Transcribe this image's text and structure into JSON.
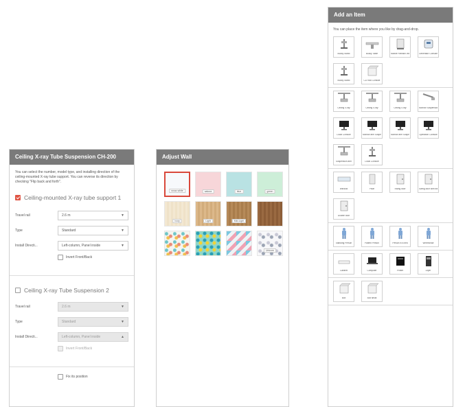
{
  "ceiling_panel": {
    "title": "Ceiling X-ray Tube Suspension CH-200",
    "description": "You can select the number, model type, and installing direction of the ceiling-mounted X-ray tube support. You can reverse its direction by checking \"Flip back and forth\".",
    "support1": {
      "label": "Ceiling-mounted X-ray tube support 1",
      "travel_rail_label": "Travel rail",
      "travel_rail_value": "2.6 m",
      "type_label": "Type",
      "type_value": "Standard",
      "install_label": "Install Directi...",
      "install_value": "Left-column, Panel inside",
      "invert_label": "Invert Front/Back"
    },
    "support2": {
      "label": "Ceiling X-ray Tube Suspension 2",
      "travel_rail_label": "Travel rail",
      "travel_rail_value": "2.6 m",
      "type_label": "Type",
      "type_value": "Standard",
      "install_label": "Install Directi...",
      "install_value": "Left-column, Panel inside",
      "invert_label": "Invert Front/Back"
    },
    "fix_label": "Fix its position"
  },
  "wall_panel": {
    "title": "Adjust Wall",
    "swatches": [
      {
        "label": "snow-white",
        "color": "#f7f9fc",
        "selected": true
      },
      {
        "label": "sakura",
        "color": "#f7d6d9"
      },
      {
        "label": "blue",
        "color": "#b9e2e3"
      },
      {
        "label": "green",
        "color": "#cdeed8"
      },
      {
        "label": "ivory",
        "cls": "wood1"
      },
      {
        "label": "Light",
        "cls": "wood2"
      },
      {
        "label": "Mid-Light",
        "cls": "wood3"
      },
      {
        "label": "",
        "cls": "wood4"
      },
      {
        "label": "",
        "cls": "pat1"
      },
      {
        "label": "",
        "cls": "pat2"
      },
      {
        "label": "",
        "cls": "pat3"
      },
      {
        "label": "Unicorn",
        "cls": "pat4"
      }
    ]
  },
  "add_panel": {
    "title": "Add an Item",
    "hint": "You can place the item where you like by drag-and-drop.",
    "groups": [
      [
        {
          "label": "Bucky Stand",
          "icon": "stand"
        },
        {
          "label": "Bucky Table",
          "icon": "table"
        },
        {
          "label": "Mobile Partition Wall",
          "icon": "partition"
        },
        {
          "label": "Generator Console",
          "icon": "console"
        },
        {
          "label": "Bucky Stand",
          "icon": "stand"
        },
        {
          "label": "CD Rad Console",
          "icon": "box"
        }
      ],
      [
        {
          "label": "Ceiling X-ray",
          "icon": "ceiling"
        },
        {
          "label": "Ceiling X-ray",
          "icon": "ceiling"
        },
        {
          "label": "Ceiling X-ray",
          "icon": "ceiling"
        },
        {
          "label": "Monitor Suspension",
          "icon": "arm"
        },
        {
          "label": "Local Console",
          "icon": "monitor"
        },
        {
          "label": "Monitor arm Suspension",
          "icon": "monitor"
        },
        {
          "label": "Monitor arm Suspension",
          "icon": "monitor"
        },
        {
          "label": "Operation Console",
          "icon": "monitor"
        },
        {
          "label": "Suspension arm",
          "icon": "ceiling"
        },
        {
          "label": "Local Console",
          "icon": "stand"
        }
      ],
      [
        {
          "label": "Window",
          "icon": "window"
        },
        {
          "label": "Pillar",
          "icon": "pillar"
        },
        {
          "label": "Swing door",
          "icon": "door"
        },
        {
          "label": "Swing door with window",
          "icon": "door"
        },
        {
          "label": "Double door",
          "icon": "door"
        }
      ],
      [
        {
          "label": "Standing Person",
          "icon": "person"
        },
        {
          "label": "Patient Person",
          "icon": "person"
        },
        {
          "label": "Person in a bed",
          "icon": "person"
        },
        {
          "label": "Wheelchair",
          "icon": "person"
        }
      ],
      [
        {
          "label": "Cabinet",
          "icon": "cabinet"
        },
        {
          "label": "Computer",
          "icon": "laptop"
        },
        {
          "label": "Printer",
          "icon": "printer"
        },
        {
          "label": "Dryer",
          "icon": "tower"
        }
      ],
      [
        {
          "label": "Box",
          "icon": "box"
        },
        {
          "label": "Box small",
          "icon": "box"
        }
      ]
    ]
  }
}
